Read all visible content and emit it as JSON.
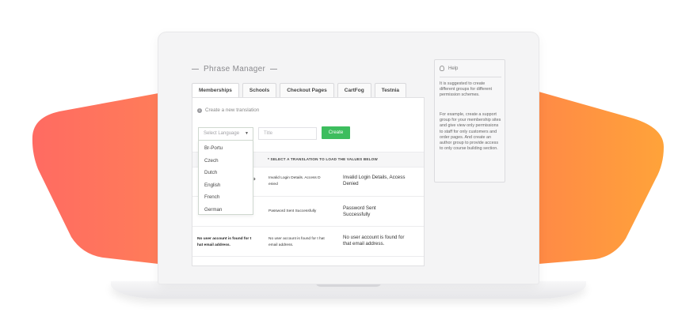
{
  "colors": {
    "accent_left": "#ff6b62",
    "accent_right": "#ff9a3c",
    "create_button": "#3dbd5e"
  },
  "page": {
    "title": "Phrase Manager"
  },
  "tabs": [
    {
      "label": "Memberships",
      "active": true
    },
    {
      "label": "Schools",
      "active": false
    },
    {
      "label": "Checkout Pages",
      "active": false
    },
    {
      "label": "CartFog",
      "active": false
    },
    {
      "label": "Testnia",
      "active": false
    }
  ],
  "form": {
    "create_link": "Create a new translation",
    "select_placeholder": "Select Language",
    "title_placeholder": "Title",
    "create_button": "Create"
  },
  "dropdown": {
    "options": [
      "Br-Portu",
      "Czech",
      "Dutch",
      "English",
      "French",
      "German"
    ]
  },
  "table": {
    "select_note": "* SELECT A TRANSLATION TO LOAD THE VALUES BELOW",
    "rows": [
      {
        "key": "",
        "key_suffix": "D",
        "value": "Invalid Login Details. Access D enied",
        "translation": "Invalid Login Details, Access Denied"
      },
      {
        "key": "",
        "key_suffix": "",
        "value": "Password Sent Successfully",
        "translation": "Password Sent Successfully"
      },
      {
        "key": "No user account is found for t hat email address.",
        "key_suffix": "",
        "value": "No user account is found for t hat email address.",
        "translation": "No user account is found for that email address."
      }
    ]
  },
  "help": {
    "title": "Help",
    "paragraph_1": "It is suggested to create different groups for different permission schemes.",
    "paragraph_2": "For example, create a support group for your membership sites and give view only permissions to staff for only customers and order pages. And create an author group to provide access to only course building section."
  }
}
